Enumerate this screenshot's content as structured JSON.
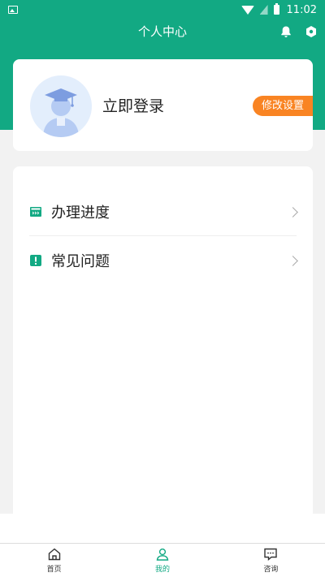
{
  "status_bar": {
    "time": "11:02",
    "icons": [
      "image-icon",
      "wifi-icon",
      "sim-icon",
      "battery-icon"
    ]
  },
  "header": {
    "title": "个人中心",
    "icons": [
      "bell-icon",
      "settings-icon"
    ]
  },
  "profile": {
    "login_text": "立即登录",
    "edit_button": "修改设置",
    "avatar_icon": "graduate-avatar-icon"
  },
  "menu": {
    "items": [
      {
        "label": "办理进度",
        "icon": "progress-icon"
      },
      {
        "label": "常见问题",
        "icon": "faq-icon"
      }
    ]
  },
  "tabbar": {
    "tabs": [
      {
        "label": "首页",
        "icon": "home-icon",
        "active": false
      },
      {
        "label": "我的",
        "icon": "user-icon",
        "active": true
      },
      {
        "label": "咨询",
        "icon": "chat-icon",
        "active": false
      }
    ]
  },
  "colors": {
    "brand": "#12a983",
    "accent": "#f98423",
    "background": "#f2f2f2"
  }
}
